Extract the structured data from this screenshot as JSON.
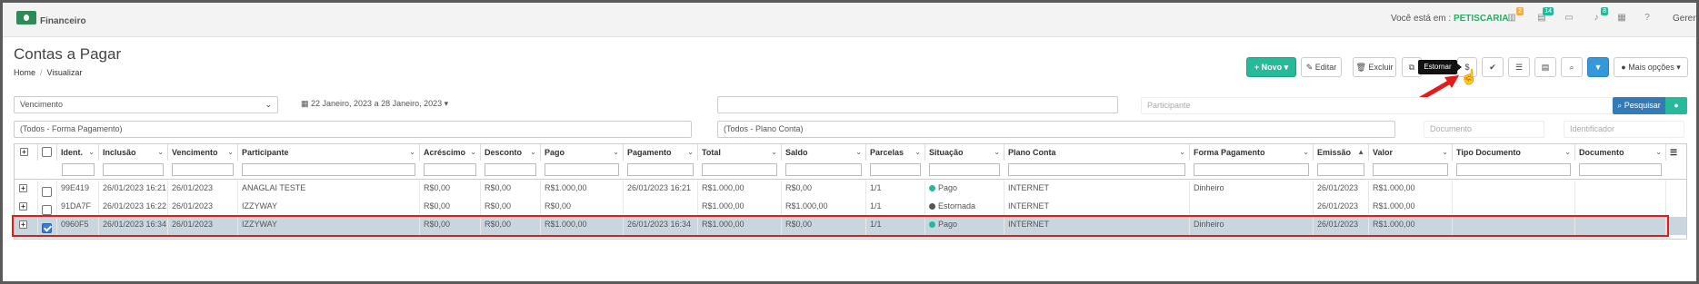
{
  "topbar": {
    "app_name": "Financeiro",
    "env_label": "Você está em :",
    "env_value": "PETISCARIA",
    "badges": [
      "2",
      "14",
      "8"
    ],
    "user": "Gerente"
  },
  "page": {
    "title": "Contas a Pagar",
    "breadcrumb": [
      "Home",
      "Visualizar"
    ]
  },
  "toolbar": {
    "novo": "+ Novo",
    "editar": "Editar",
    "excluir": "Excluir",
    "estornar_tooltip": "Estornar",
    "mais_opcoes": "Mais opções"
  },
  "filters": {
    "date_field": "Vencimento",
    "date_range": "22 Janeiro, 2023 a 28 Janeiro, 2023",
    "participante_placeholder": "Participante",
    "pesquisar": "Pesquisar",
    "forma_pagamento": "(Todos - Forma Pagamento)",
    "plano_conta": "(Todos - Plano Conta)",
    "documento_placeholder": "Documento",
    "identificador_placeholder": "Identificador"
  },
  "table": {
    "columns": [
      "Ident.",
      "Inclusão",
      "Vencimento",
      "Participante",
      "Acréscimo",
      "Desconto",
      "Pago",
      "Pagamento",
      "Total",
      "Saldo",
      "Parcelas",
      "Situação",
      "Plano Conta",
      "Forma Pagamento",
      "Emissão",
      "Valor",
      "Tipo Documento",
      "Documento"
    ],
    "rows": [
      {
        "ident": "99E419",
        "inclusao": "26/01/2023 16:21",
        "vencimento": "26/01/2023",
        "participante": "ANAGLAI TESTE",
        "acrescimo": "R$0,00",
        "desconto": "R$0,00",
        "pago": "R$1.000,00",
        "pagamento": "26/01/2023 16:21",
        "total": "R$1.000,00",
        "saldo": "R$0,00",
        "parcelas": "1/1",
        "situacao": "Pago",
        "plano": "INTERNET",
        "forma": "Dinheiro",
        "emissao": "26/01/2023",
        "valor": "R$1.000,00",
        "tipo": "",
        "documento": ""
      },
      {
        "ident": "91DA7F",
        "inclusao": "26/01/2023 16:22",
        "vencimento": "26/01/2023",
        "participante": "IZZYWAY",
        "acrescimo": "R$0,00",
        "desconto": "R$0,00",
        "pago": "R$0,00",
        "pagamento": "",
        "total": "R$1.000,00",
        "saldo": "R$1.000,00",
        "parcelas": "1/1",
        "situacao": "Estornada",
        "plano": "INTERNET",
        "forma": "",
        "emissao": "26/01/2023",
        "valor": "R$1.000,00",
        "tipo": "",
        "documento": ""
      },
      {
        "ident": "0960F5",
        "inclusao": "26/01/2023 16:34",
        "vencimento": "26/01/2023",
        "participante": "IZZYWAY",
        "acrescimo": "R$0,00",
        "desconto": "R$0,00",
        "pago": "R$1.000,00",
        "pagamento": "26/01/2023 16:34",
        "total": "R$1.000,00",
        "saldo": "R$0,00",
        "parcelas": "1/1",
        "situacao": "Pago",
        "plano": "INTERNET",
        "forma": "Dinheiro",
        "emissao": "26/01/2023",
        "valor": "R$1.000,00",
        "tipo": "",
        "documento": ""
      }
    ]
  },
  "colors": {
    "pago": "#26b99a",
    "estornada": "#555555",
    "highlight": "#e21b1b"
  }
}
